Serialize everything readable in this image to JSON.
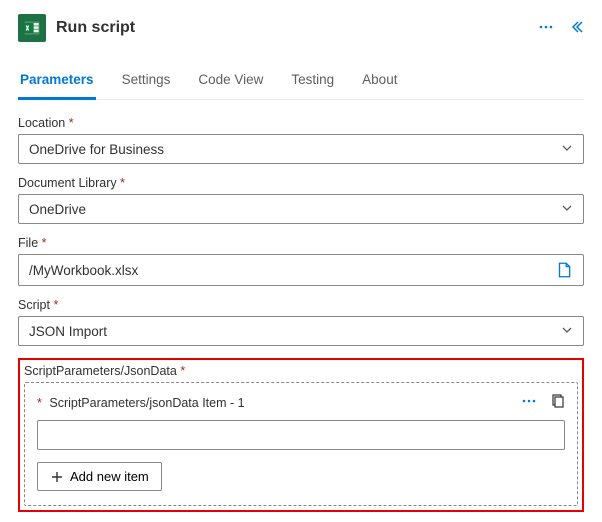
{
  "header": {
    "title": "Run script"
  },
  "tabs": [
    {
      "label": "Parameters",
      "active": true
    },
    {
      "label": "Settings",
      "active": false
    },
    {
      "label": "Code View",
      "active": false
    },
    {
      "label": "Testing",
      "active": false
    },
    {
      "label": "About",
      "active": false
    }
  ],
  "fields": {
    "location": {
      "label": "Location",
      "required": true,
      "value": "OneDrive for Business"
    },
    "library": {
      "label": "Document Library",
      "required": true,
      "value": "OneDrive"
    },
    "file": {
      "label": "File",
      "required": true,
      "value": "/MyWorkbook.xlsx"
    },
    "script": {
      "label": "Script",
      "required": true,
      "value": "JSON Import"
    }
  },
  "scriptParams": {
    "sectionLabel": "ScriptParameters/JsonData",
    "required": true,
    "itemLabel": "ScriptParameters/jsonData Item - 1",
    "itemValue": "",
    "addButton": "Add new item"
  }
}
